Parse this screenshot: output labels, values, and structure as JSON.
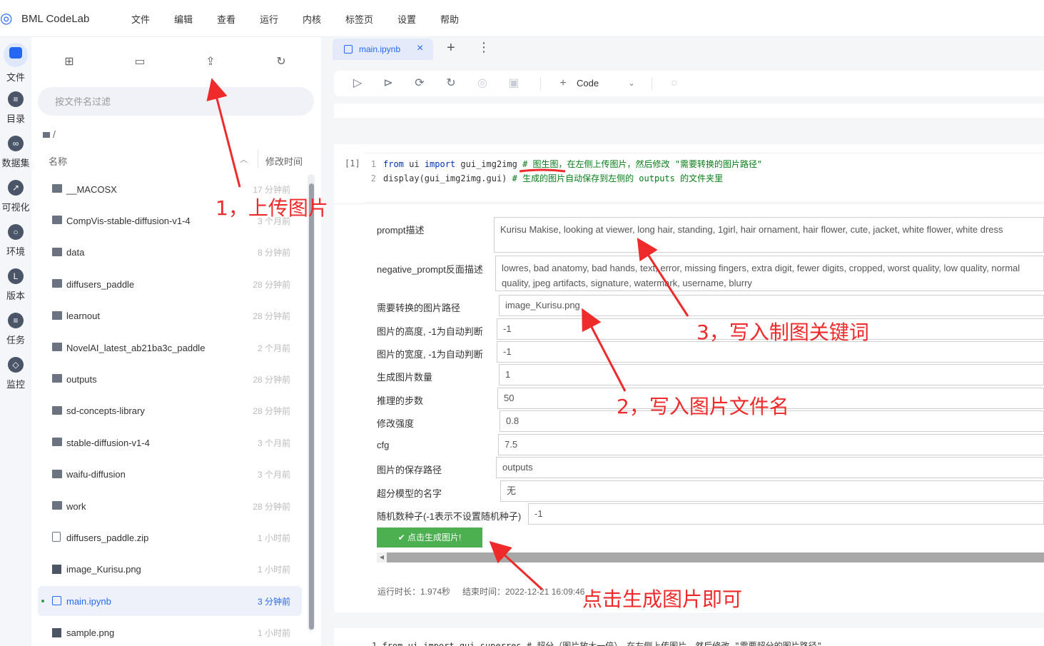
{
  "app": {
    "title": "BML CodeLab",
    "logo_icon": "bml-logo-icon"
  },
  "menu": [
    "文件",
    "编辑",
    "查看",
    "运行",
    "内核",
    "标签页",
    "设置",
    "帮助"
  ],
  "rail": [
    {
      "label": "文件",
      "icon": "folder-icon",
      "active": true
    },
    {
      "label": "目录",
      "icon": "list-icon"
    },
    {
      "label": "数据集",
      "icon": "dataset-icon"
    },
    {
      "label": "可视化",
      "icon": "chart-icon"
    },
    {
      "label": "环境",
      "icon": "environment-icon"
    },
    {
      "label": "版本",
      "icon": "clock-icon"
    },
    {
      "label": "任务",
      "icon": "task-icon"
    },
    {
      "label": "监控",
      "icon": "monitor-icon"
    }
  ],
  "filepanel": {
    "filter_placeholder": "按文件名过滤",
    "breadcrumb": "/",
    "col_name": "名称",
    "col_time": "修改时间",
    "files": [
      {
        "name": "__MACOSX",
        "time": "17 分钟前",
        "type": "folder"
      },
      {
        "name": "CompVis-stable-diffusion-v1-4",
        "time": "3 个月前",
        "type": "folder"
      },
      {
        "name": "data",
        "time": "8 分钟前",
        "type": "folder"
      },
      {
        "name": "diffusers_paddle",
        "time": "28 分钟前",
        "type": "folder"
      },
      {
        "name": "learnout",
        "time": "28 分钟前",
        "type": "folder"
      },
      {
        "name": "NovelAI_latest_ab21ba3c_paddle",
        "time": "2 个月前",
        "type": "folder"
      },
      {
        "name": "outputs",
        "time": "28 分钟前",
        "type": "folder"
      },
      {
        "name": "sd-concepts-library",
        "time": "28 分钟前",
        "type": "folder"
      },
      {
        "name": "stable-diffusion-v1-4",
        "time": "3 个月前",
        "type": "folder"
      },
      {
        "name": "waifu-diffusion",
        "time": "3 个月前",
        "type": "folder"
      },
      {
        "name": "work",
        "time": "28 分钟前",
        "type": "folder"
      },
      {
        "name": "diffusers_paddle.zip",
        "time": "1 小时前",
        "type": "file"
      },
      {
        "name": "image_Kurisu.png",
        "time": "1 小时前",
        "type": "image"
      },
      {
        "name": "main.ipynb",
        "time": "3 分钟前",
        "type": "notebook",
        "active": true
      },
      {
        "name": "sample.png",
        "time": "1 小时前",
        "type": "image"
      }
    ]
  },
  "tab": {
    "label": "main.ipynb"
  },
  "toolbar": {
    "code_label": "Code"
  },
  "cell": {
    "number": "[1]",
    "line1_ln": "1",
    "line1_a": "from",
    "line1_b": " ui ",
    "line1_c": "import",
    "line1_d": " gui_img2img ",
    "line1_comment": "# 图生图，在左侧上传图片，然后修改 \"需要转换的图片路径\"",
    "line2_ln": "2",
    "line2_code": "display(gui_img2img.gui) ",
    "line2_comment": "# 生成的图片自动保存到左侧的 outputs 的文件夹里"
  },
  "form": {
    "prompt_label": "prompt描述",
    "prompt_value": "Kurisu Makise, looking at viewer, long hair, standing, 1girl, hair ornament, hair flower, cute, jacket, white flower, white dress",
    "neg_label": "negative_prompt反面描述",
    "neg_value": "lowres, bad anatomy, bad hands, text, error, missing fingers, extra digit, fewer digits, cropped, worst quality, low quality, normal quality, jpeg artifacts, signature, watermark, username, blurry",
    "path_label": "需要转换的图片路径",
    "path_value": "image_Kurisu.png",
    "height_label": "图片的高度, -1为自动判断",
    "height_value": "-1",
    "width_label": "图片的宽度, -1为自动判断",
    "width_value": "-1",
    "count_label": "生成图片数量",
    "count_value": "1",
    "steps_label": "推理的步数",
    "steps_value": "50",
    "strength_label": "修改强度",
    "strength_value": "0.8",
    "cfg_label": "cfg",
    "cfg_value": "7.5",
    "save_label": "图片的保存路径",
    "save_value": "outputs",
    "sr_label": "超分模型的名字",
    "sr_value": "无",
    "seed_label": "随机数种子(-1表示不设置随机种子)",
    "seed_value": "-1",
    "generate_label": "✔ 点击生成图片!"
  },
  "runinfo": {
    "duration": "运行时长：1.974秒",
    "end": "结束时间：2022-12-21 16:09:46"
  },
  "cell2_text": "1  from ui import gui_superres # 超分（图片放大一倍），在左侧上传图片，然后修改 \"需要超分的图片路径\"",
  "annotations": {
    "a1": "1，上传图片",
    "a2": "2，写入图片文件名",
    "a3": "3，写入制图关键词",
    "a4": "点击生成图片即可",
    "color": "#ee2a2a"
  }
}
